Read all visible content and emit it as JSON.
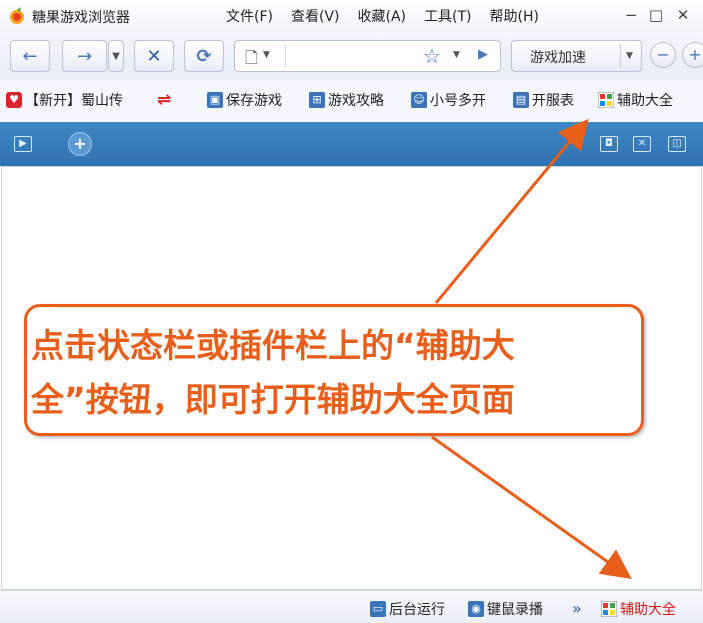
{
  "window": {
    "title": "糖果游戏浏览器",
    "min": "−",
    "max": "□",
    "close": "✕"
  },
  "menu": [
    "文件(F)",
    "查看(V)",
    "收藏(A)",
    "工具(T)",
    "帮助(H)"
  ],
  "toolbar": {
    "back": "←",
    "forward": "→",
    "stop": "✕",
    "refresh": "⟳",
    "url_value": "",
    "speed_label": "游戏加速",
    "zoom_out": "−"
  },
  "bookmarks": {
    "new_tab_item": "【新开】蜀山传",
    "swap": "⇌",
    "items": [
      "保存游戏",
      "游戏攻略",
      "小号多开",
      "开服表",
      "辅助大全"
    ]
  },
  "tabbar": {
    "add": "+"
  },
  "callout": {
    "line1": "点击状态栏或插件栏上的“辅助大",
    "line2": "全”按钮，即可打开辅助大全页面"
  },
  "statusbar": {
    "background_run": "后台运行",
    "macro_record": "键鼠录播",
    "more": "»",
    "assist": "辅助大全"
  },
  "colors": {
    "accent_orange": "#e85f1c",
    "tab_blue": "#3a82c0",
    "assist_red": "#d01818"
  }
}
